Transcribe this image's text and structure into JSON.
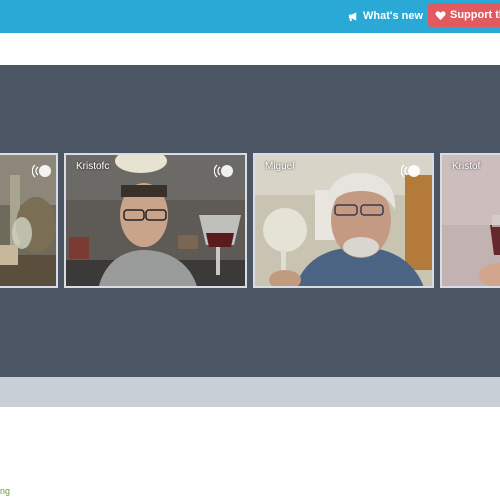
{
  "header": {
    "whats_new_label": "What's new",
    "support_label": "Support the"
  },
  "participants": [
    {
      "name": ""
    },
    {
      "name": "Kristofc"
    },
    {
      "name": "Miguel"
    },
    {
      "name": "Kristof"
    }
  ],
  "footer": {
    "text": "ng"
  },
  "colors": {
    "topbar": "#2aa9d6",
    "support_button": "#e05a5f",
    "video_stage": "#4b5563",
    "strip": "#c9cfd7"
  },
  "icons": {
    "whats_new": "megaphone-icon",
    "support": "heart-icon",
    "audio": "audio-level-icon"
  }
}
